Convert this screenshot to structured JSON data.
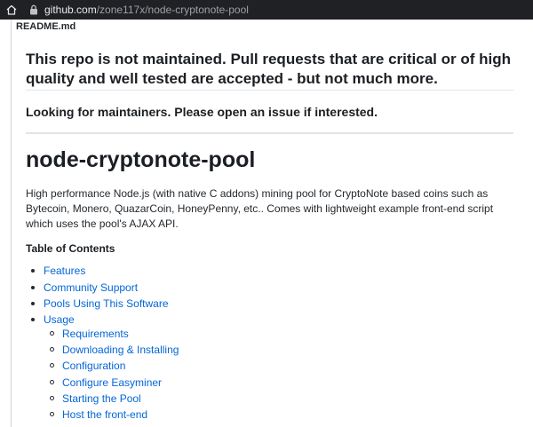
{
  "browser": {
    "url_domain": "github.com",
    "url_path": "/zone117x/node-cryptonote-pool"
  },
  "readme": {
    "file_label": "README.md",
    "notice_heading": "This repo is not maintained. Pull requests that are critical or of high quality and well tested are accepted - but not much more.",
    "maintainers_heading": "Looking for maintainers. Please open an issue if interested.",
    "title": "node-cryptonote-pool",
    "description": "High performance Node.js (with native C addons) mining pool for CryptoNote based coins such as Bytecoin, Monero, QuazarCoin, HoneyPenny, etc.. Comes with lightweight example front-end script which uses the pool's AJAX API.",
    "toc_heading": "Table of Contents",
    "toc": [
      "Features",
      "Community Support",
      "Pools Using This Software",
      "Usage"
    ],
    "toc_usage_sub": [
      "Requirements",
      "Downloading & Installing",
      "Configuration",
      "Configure Easyminer",
      "Starting the Pool",
      "Host the front-end"
    ]
  },
  "colors": {
    "link": "#0366d6",
    "url_bar_bg": "#202124"
  },
  "icons": {
    "home": "home-icon",
    "lock": "lock-icon"
  }
}
